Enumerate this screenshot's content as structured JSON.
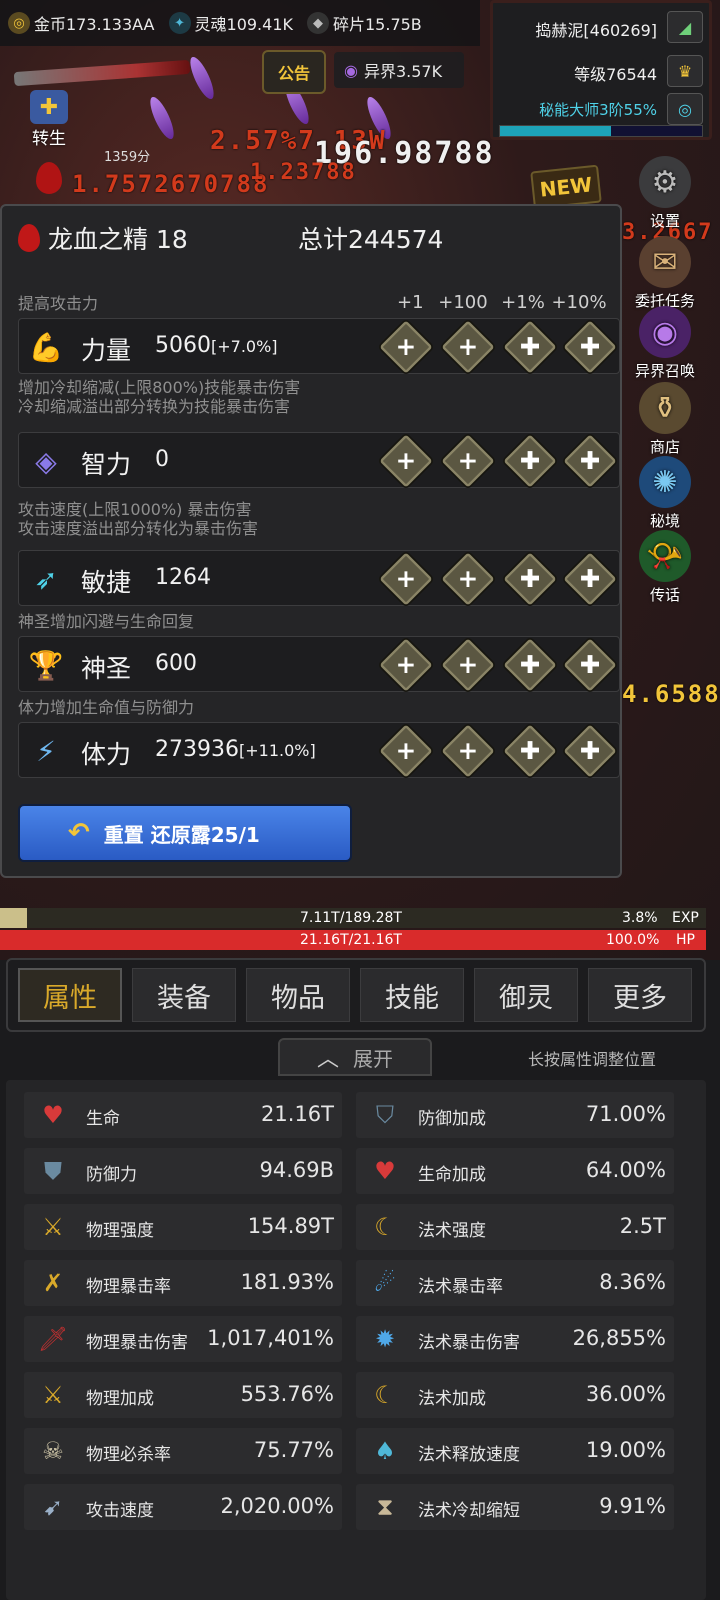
{
  "currencies": [
    {
      "label": "金币173.133AA",
      "icon": "gold-coin-icon",
      "color": "#d2a63a"
    },
    {
      "label": "灵魂109.41K",
      "icon": "soul-icon",
      "color": "#4fb8d8"
    },
    {
      "label": "碎片15.75B",
      "icon": "shard-icon",
      "color": "#9a9a9a"
    }
  ],
  "announce_label": "公告",
  "otherworld_label": "异界3.57K",
  "rebirth_label": "转生",
  "timer_text": "1359分",
  "new_badge": "NEW",
  "player": {
    "name": "捣赫泥[460269]",
    "level": "等级76544",
    "mastery": "秘能大师3阶55%",
    "mastery_progress": 0.55
  },
  "side_menu": [
    {
      "label": "设置",
      "icon": "gear-icon"
    },
    {
      "label": "委托任务",
      "icon": "quest-icon"
    },
    {
      "label": "异界召唤",
      "icon": "portal-icon"
    },
    {
      "label": "商店",
      "icon": "shop-icon"
    },
    {
      "label": "秘境",
      "icon": "vortex-icon"
    },
    {
      "label": "传话",
      "icon": "horn-icon"
    }
  ],
  "damage_numbers": [
    "2.57%7.13W",
    "196.98788",
    "1.7572670788",
    "1.23788",
    "3.2667",
    "4.6588"
  ],
  "dialog": {
    "title": "龙血之精 18",
    "total": "总计244574",
    "columns": [
      "+1",
      "+100",
      "+1%",
      "+10%"
    ],
    "hints": [
      "提高攻击力",
      "增加冷却缩减(上限800%)技能暴击伤害\n冷却缩减溢出部分转换为技能暴击伤害",
      "攻击速度(上限1000%) 暴击伤害\n攻击速度溢出部分转化为暴击伤害",
      "神圣增加闪避与生命回复",
      "体力增加生命值与防御力"
    ],
    "stats": [
      {
        "name": "力量",
        "value": "5060",
        "bonus": "[+7.0%]",
        "icon": "strength-arm-icon"
      },
      {
        "name": "智力",
        "value": "0",
        "bonus": "",
        "icon": "intellect-orb-icon"
      },
      {
        "name": "敏捷",
        "value": "1264",
        "bonus": "",
        "icon": "agility-boot-icon"
      },
      {
        "name": "神圣",
        "value": "600",
        "bonus": "",
        "icon": "holy-chalice-icon"
      },
      {
        "name": "体力",
        "value": "273936",
        "bonus": "[+11.0%]",
        "icon": "stamina-bolt-icon"
      }
    ],
    "plus_glyphs": [
      "+",
      "+",
      "⁺⁄₊",
      "⁺⁄₊"
    ],
    "reset_label": "重置 还原露25/1"
  },
  "exp_bar": {
    "value": "7.11T/189.28T",
    "percent": "3.8%",
    "label": "EXP",
    "fill": 0.038
  },
  "hp_bar": {
    "value": "21.16T/21.16T",
    "percent": "100.0%",
    "label": "HP",
    "fill": 1.0
  },
  "tabs": [
    "属性",
    "装备",
    "物品",
    "技能",
    "御灵",
    "更多"
  ],
  "active_tab": 0,
  "expand_label": "展开",
  "longpress_hint": "长按属性调整位置",
  "attributes": [
    {
      "name": "生命",
      "value": "21.16T",
      "icon": "heart-icon"
    },
    {
      "name": "防御加成",
      "value": "71.00%",
      "icon": "shield-down-icon"
    },
    {
      "name": "防御力",
      "value": "94.69B",
      "icon": "shield-icon"
    },
    {
      "name": "生命加成",
      "value": "64.00%",
      "icon": "heart-plus-icon"
    },
    {
      "name": "物理强度",
      "value": "154.89T",
      "icon": "sword-icon"
    },
    {
      "name": "法术强度",
      "value": "2.5T",
      "icon": "magic-claw-icon"
    },
    {
      "name": "物理暴击率",
      "value": "181.93%",
      "icon": "crit-sword-icon"
    },
    {
      "name": "法术暴击率",
      "value": "8.36%",
      "icon": "magic-crit-icon"
    },
    {
      "name": "物理暴击伤害",
      "value": "1,017,401%",
      "icon": "blood-sword-icon"
    },
    {
      "name": "法术暴击伤害",
      "value": "26,855%",
      "icon": "magic-burst-icon"
    },
    {
      "name": "物理加成",
      "value": "553.76%",
      "icon": "sword-plus-icon"
    },
    {
      "name": "法术加成",
      "value": "36.00%",
      "icon": "magic-plus-icon"
    },
    {
      "name": "物理必杀率",
      "value": "75.77%",
      "icon": "skull-icon"
    },
    {
      "name": "法术释放速度",
      "value": "19.00%",
      "icon": "mushroom-icon"
    },
    {
      "name": "攻击速度",
      "value": "2,020.00%",
      "icon": "attack-speed-icon"
    },
    {
      "name": "法术冷却缩短",
      "value": "9.91%",
      "icon": "hourglass-icon"
    }
  ]
}
